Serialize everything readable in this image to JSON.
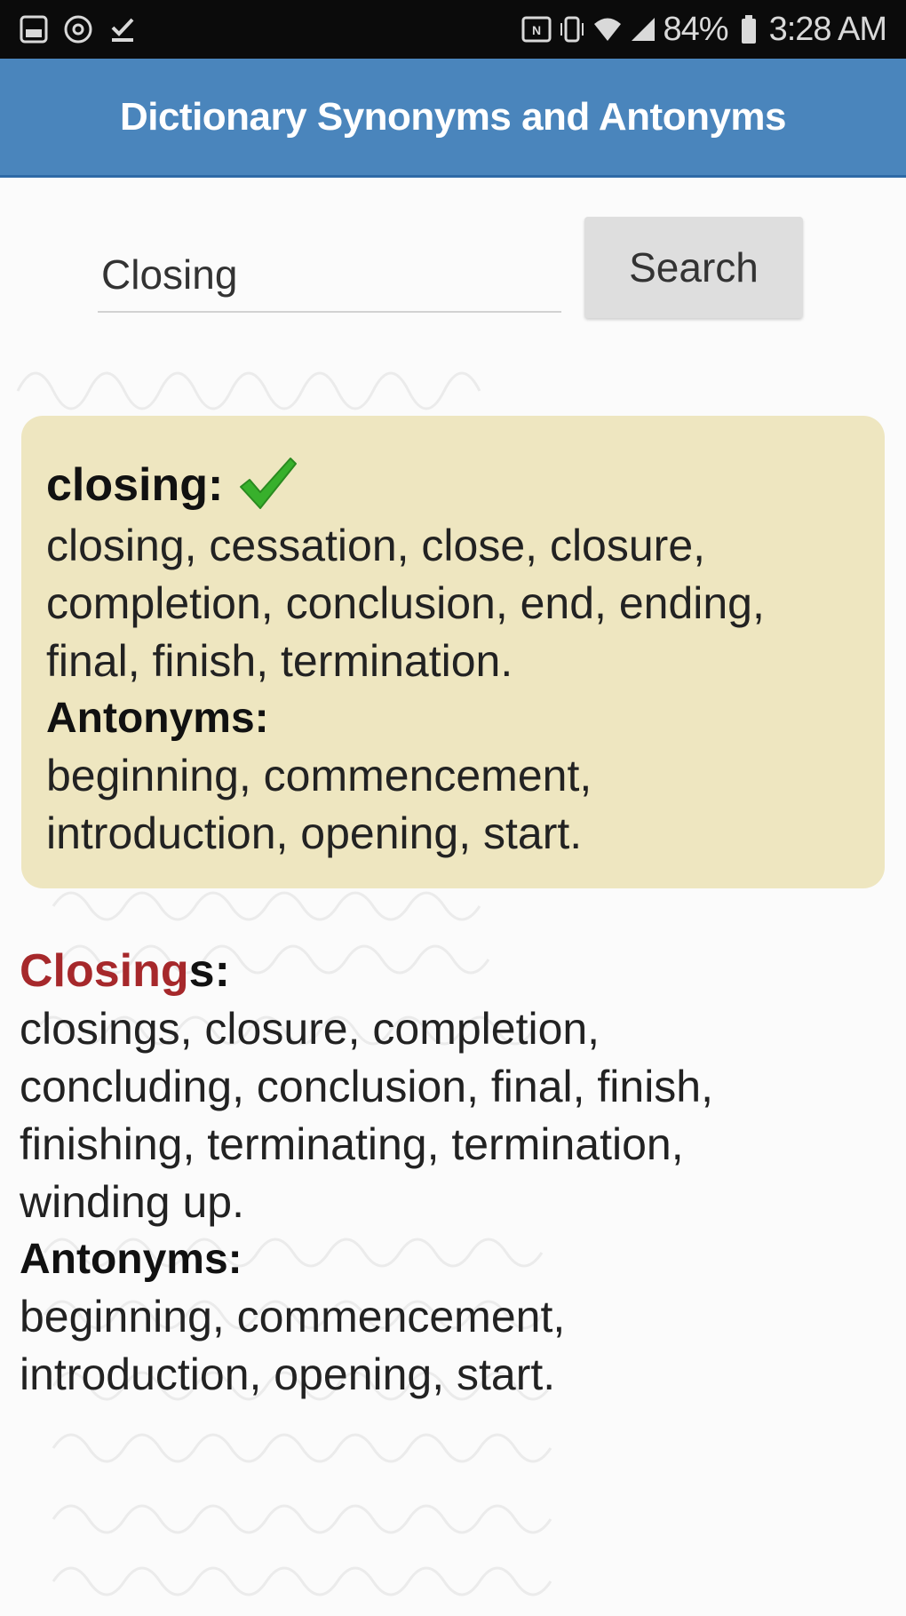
{
  "status_bar": {
    "battery": "84%",
    "time": "3:28 AM",
    "left_icons": [
      "gallery-icon",
      "at-sign-icon",
      "download-check-icon"
    ],
    "right_icons": [
      "nfc-icon",
      "vibrate-icon",
      "wifi-icon",
      "signal-icon",
      "battery-icon"
    ]
  },
  "app_bar": {
    "title": "Dictionary Synonyms and Antonyms",
    "color": "#4a85bc"
  },
  "search": {
    "value": "Closing",
    "button_label": "Search"
  },
  "primary_entry": {
    "word": "closing:",
    "synonyms_lines": [
      "closing, cessation, close, closure,",
      "completion, conclusion, end, ending,",
      "final, finish, termination."
    ],
    "antonyms_label": "Antonyms:",
    "antonyms_lines": [
      "beginning, commencement,",
      "introduction, opening, start."
    ],
    "card_color": "#eee6c0"
  },
  "related_entry": {
    "highlight": "Closing",
    "suffix": "s:",
    "highlight_color": "#a6282b",
    "synonyms_lines": [
      "closings, closure, completion,",
      "concluding, conclusion, final, finish,",
      "finishing, terminating, termination,",
      "winding up."
    ],
    "antonyms_label": "Antonyms:",
    "antonyms_lines": [
      "beginning, commencement,",
      "introduction, opening, start."
    ]
  }
}
